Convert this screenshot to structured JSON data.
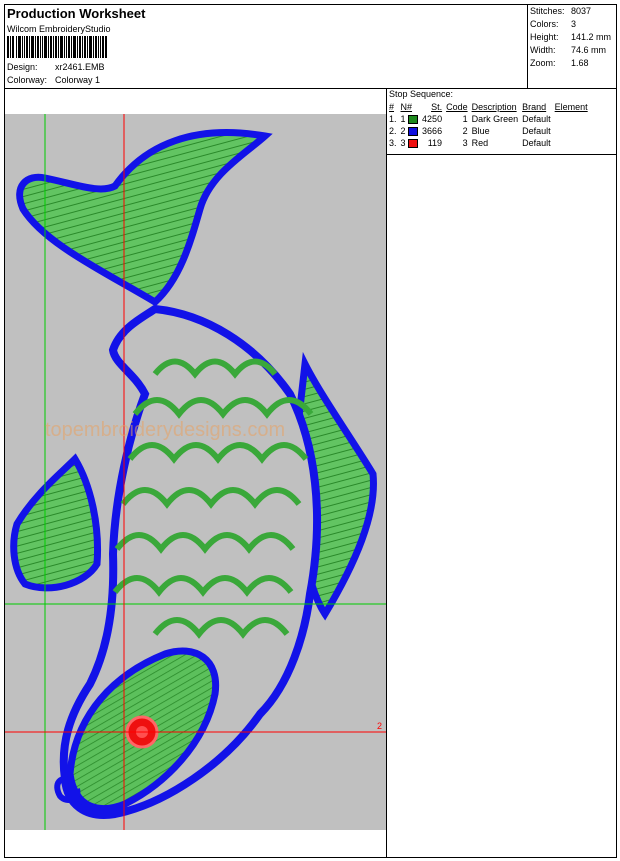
{
  "header": {
    "title": "Production Worksheet",
    "subtitle": "Wilcom EmbroideryStudio",
    "design_label": "Design:",
    "design_value": "xr2461.EMB",
    "colorway_label": "Colorway:",
    "colorway_value": "Colorway 1"
  },
  "stats": {
    "stitches_label": "Stitches:",
    "stitches_value": "8037",
    "colors_label": "Colors:",
    "colors_value": "3",
    "height_label": "Height:",
    "height_value": "141.2 mm",
    "width_label": "Width:",
    "width_value": "74.6 mm",
    "zoom_label": "Zoom:",
    "zoom_value": "1.68"
  },
  "stop_sequence": {
    "title": "Stop Sequence:",
    "columns": [
      "#",
      "N#",
      "St.",
      "Code",
      "Description",
      "Brand",
      "Element"
    ],
    "rows": [
      {
        "idx": "1.",
        "n": "1",
        "color": "#1e8a1e",
        "code": "4250",
        "st_code": "1",
        "description": "Dark Green",
        "brand": "Default",
        "element": ""
      },
      {
        "idx": "2.",
        "n": "2",
        "color": "#1010e0",
        "code": "3666",
        "st_code": "2",
        "description": "Blue",
        "brand": "Default",
        "element": ""
      },
      {
        "idx": "3.",
        "n": "3",
        "color": "#ee1010",
        "code": "119",
        "st_code": "3",
        "description": "Red",
        "brand": "Default",
        "element": ""
      }
    ]
  },
  "canvas": {
    "background": "#c0c0c0",
    "watermark": "topembroiderydesigns.com",
    "crosshair_marker": "2",
    "colors": {
      "green": "#46b046",
      "blue": "#1212e8",
      "red": "#ee1010",
      "guide_green": "#00cc00",
      "guide_red": "#ff0000"
    }
  }
}
